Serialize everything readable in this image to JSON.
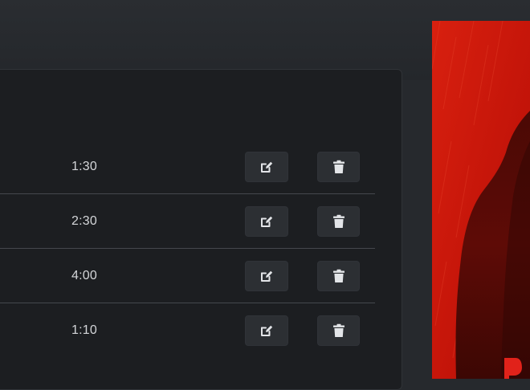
{
  "songs": [
    {
      "duration": "1:30"
    },
    {
      "duration": "2:30"
    },
    {
      "duration": "4:00"
    },
    {
      "duration": "1:10"
    }
  ],
  "icons": {
    "edit": "edit-icon",
    "delete": "trash-icon"
  },
  "colors": {
    "page_background": "#26292d",
    "panel_background": "#1c1e21",
    "button_background": "#2c2f33",
    "poster_red": "#c8160d",
    "text": "#d4d6d9"
  }
}
